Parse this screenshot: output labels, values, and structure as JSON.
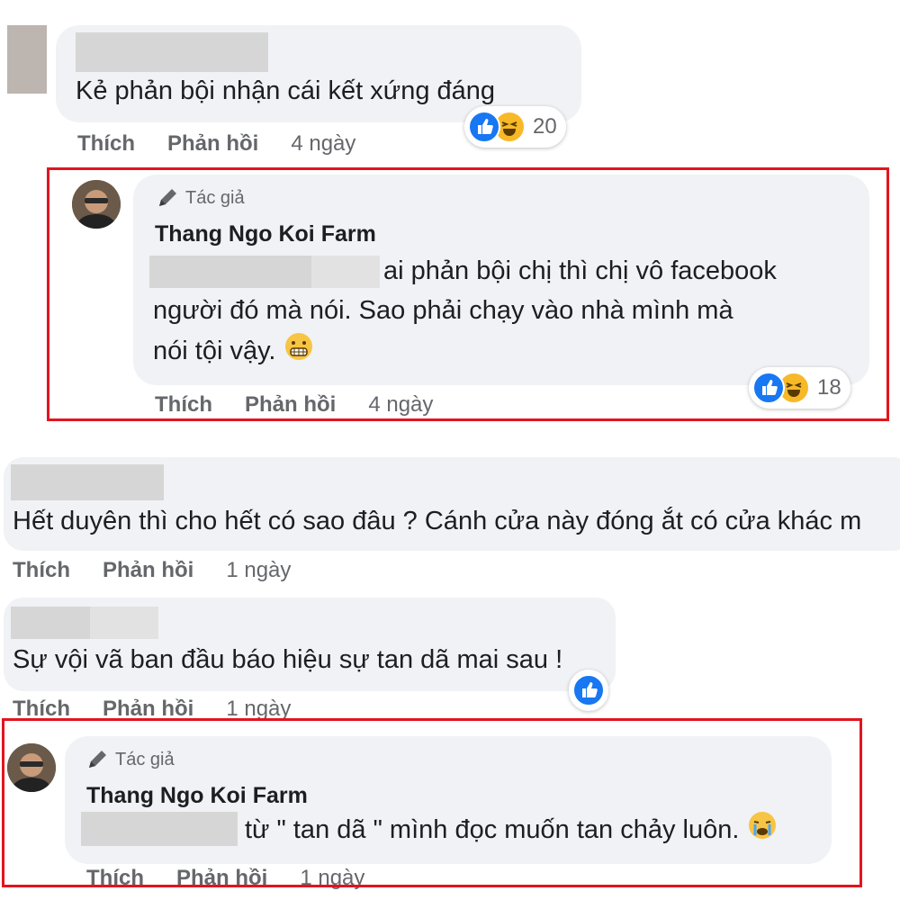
{
  "comments": [
    {
      "text": "Kẻ phản bội nhận cái kết xứng đáng",
      "actions": {
        "like": "Thích",
        "reply": "Phản hồi",
        "time": "4 ngày"
      },
      "reactions": {
        "icons": [
          "like-icon",
          "haha-icon"
        ],
        "count": "20"
      }
    },
    {
      "author_badge": "Tác giả",
      "author_name": "Thang Ngo Koi Farm",
      "lines": [
        "ai phản bội chị thì chị vô facebook",
        "người đó mà nói. Sao phải chạy vào nhà mình mà",
        "nói tội vậy."
      ],
      "emoji": "grimace-emoji",
      "actions": {
        "like": "Thích",
        "reply": "Phản hồi",
        "time": "4 ngày"
      },
      "reactions": {
        "icons": [
          "like-icon",
          "haha-icon"
        ],
        "count": "18"
      }
    },
    {
      "text": "Hết duyên thì cho hết có sao đâu ? Cánh cửa này đóng ắt có cửa khác m",
      "actions": {
        "like": "Thích",
        "reply": "Phản hồi",
        "time": "1 ngày"
      }
    },
    {
      "text": "Sự vội vã ban đầu báo hiệu sự tan dã mai sau !",
      "actions": {
        "like": "Thích",
        "reply": "Phản hồi",
        "time": "1 ngày"
      },
      "reactions": {
        "icons": [
          "like-icon"
        ]
      }
    },
    {
      "author_badge": "Tác giả",
      "author_name": "Thang Ngo Koi Farm",
      "text": "từ \" tan dã \" mình đọc muốn tan chảy luôn.",
      "emoji": "crying-emoji",
      "actions": {
        "like": "Thích",
        "reply": "Phản hồi",
        "time": "1 ngày"
      }
    }
  ],
  "colors": {
    "highlight_border": "#e3141f",
    "bubble": "#f0f2f5",
    "like_blue": "#1877f2",
    "haha_yellow": "#f7b928"
  }
}
